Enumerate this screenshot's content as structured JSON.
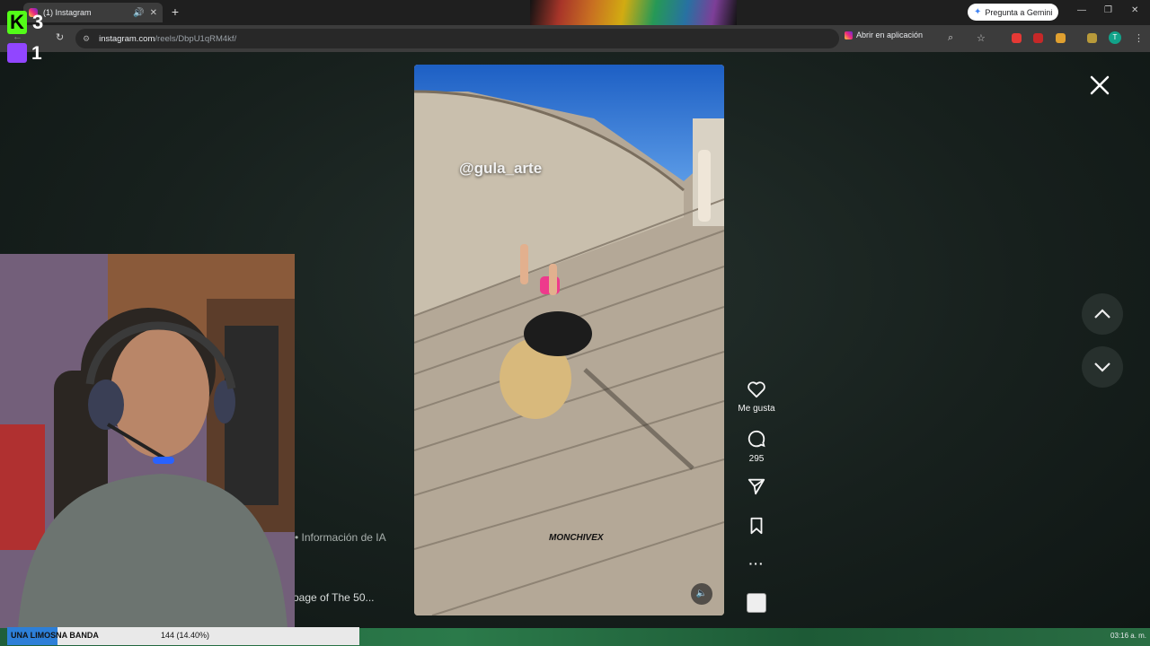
{
  "browser": {
    "tab_title": "(1) Instagram",
    "url_host": "instagram.com",
    "url_path": "/reels/DbpU1qRM4kf/",
    "gemini_label": "Pregunta a Gemini",
    "open_app_label": "Abrir en aplicación",
    "profile_initial": "T"
  },
  "stream_overlay": {
    "kick_letter": "K",
    "kick_count": "3",
    "twitch_count": "1",
    "goal_label": "UNA LIMOSNA BANDA",
    "goal_progress_text": "144 (14.40%)",
    "goal_fraction": 0.144,
    "clock": "03:16 a. m."
  },
  "reel": {
    "watermark": "@gula_arte",
    "signature": "MONCHIVEX",
    "like_label": "Me gusta",
    "comments_count": "295",
    "ai_info": "• Información de IA",
    "song": "oage of The 50..."
  },
  "colors": {
    "kick_green": "#53fc18",
    "twitch_purple": "#9146ff",
    "goal_blue": "#2d7fd8"
  }
}
